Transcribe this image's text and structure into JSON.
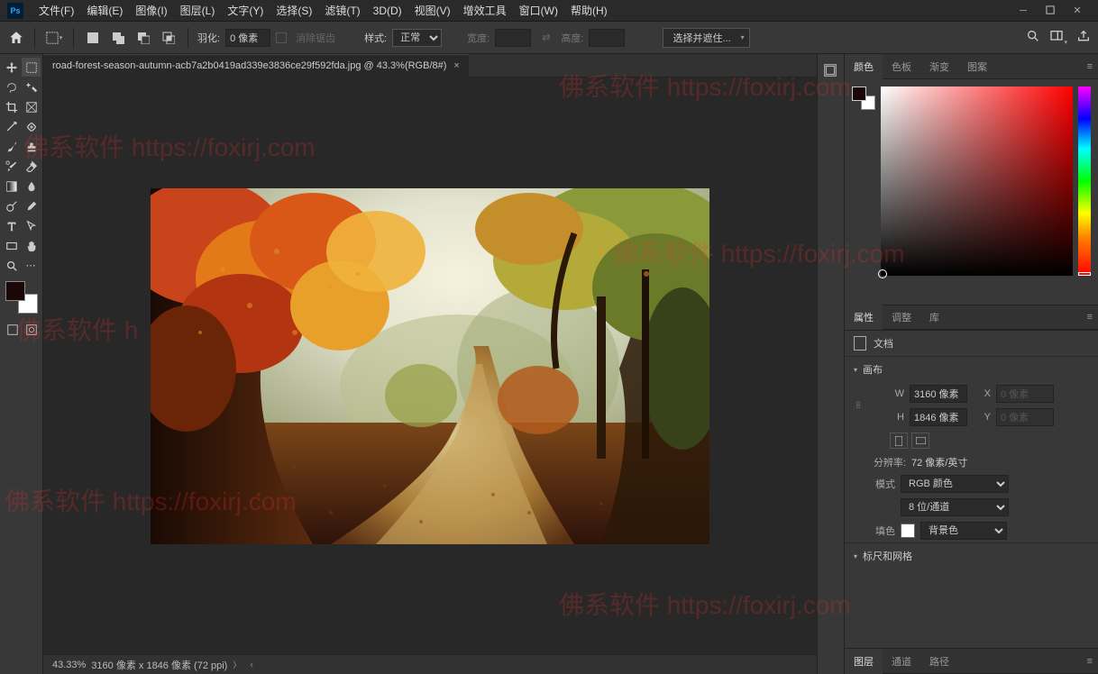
{
  "menu": {
    "items": [
      "文件(F)",
      "编辑(E)",
      "图像(I)",
      "图层(L)",
      "文字(Y)",
      "选择(S)",
      "滤镜(T)",
      "3D(D)",
      "视图(V)",
      "增效工具",
      "窗口(W)",
      "帮助(H)"
    ]
  },
  "optbar": {
    "feather_label": "羽化:",
    "feather_val": "0 像素",
    "antialias": "消除锯齿",
    "style_label": "样式:",
    "style_val": "正常",
    "width_label": "宽度:",
    "height_label": "高度:",
    "select_mask": "选择并遮住..."
  },
  "doc": {
    "tab_title": "road-forest-season-autumn-acb7a2b0419ad339e3836ce29f592fda.jpg @ 43.3%(RGB/8#)",
    "zoom": "43.33%",
    "dims": "3160 像素 x 1846 像素 (72 ppi)"
  },
  "right_tabs": {
    "color": "颜色",
    "swatches": "色板",
    "gradients": "渐变",
    "patterns": "图案",
    "properties": "属性",
    "adjustments": "调整",
    "libraries": "库",
    "layers": "图层",
    "channels": "通道",
    "paths": "路径"
  },
  "props": {
    "doc_label": "文档",
    "canvas_title": "画布",
    "w_label": "W",
    "w_val": "3160 像素",
    "h_label": "H",
    "h_val": "1846 像素",
    "x_label": "X",
    "x_val": "0 像素",
    "y_label": "Y",
    "y_val": "0 像素",
    "res_label": "分辨率:",
    "res_val": "72 像素/英寸",
    "mode_label": "模式",
    "mode_val": "RGB 颜色",
    "bits_val": "8 位/通道",
    "fill_label": "填色",
    "fill_val": "背景色",
    "rulers_title": "标尺和网格"
  },
  "watermark": "佛系软件 https://foxirj.com",
  "tools": [
    [
      "move-tool",
      "marquee-tool"
    ],
    [
      "lasso-tool",
      "wand-tool"
    ],
    [
      "crop-tool",
      "frame-tool"
    ],
    [
      "eyedropper-tool",
      "healing-tool"
    ],
    [
      "brush-tool",
      "stamp-tool"
    ],
    [
      "history-brush-tool",
      "eraser-tool"
    ],
    [
      "gradient-tool",
      "blur-tool"
    ],
    [
      "dodge-tool",
      "pen-tool"
    ],
    [
      "type-tool",
      "path-select-tool"
    ],
    [
      "rectangle-tool",
      "hand-tool"
    ],
    [
      "zoom-tool",
      "more-tool"
    ]
  ]
}
